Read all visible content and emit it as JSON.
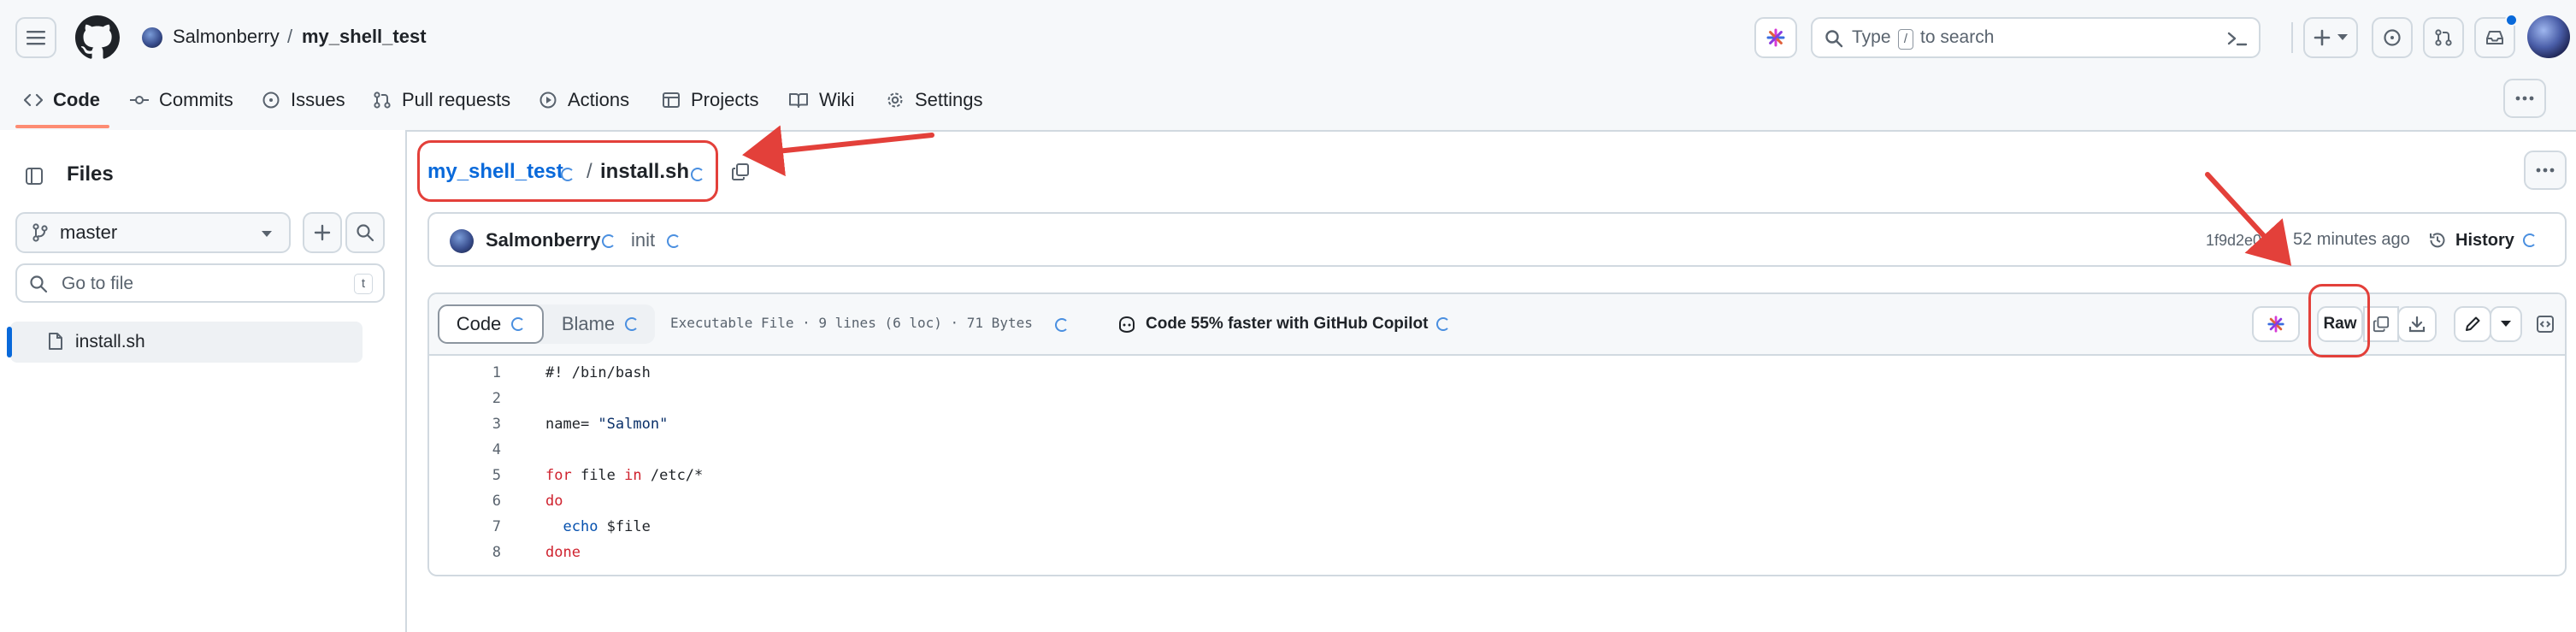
{
  "header": {
    "owner": "Salmonberry",
    "separator": "/",
    "repo": "my_shell_test",
    "search_placeholder_pre": "Type",
    "search_key": "/",
    "search_placeholder_post": "to search"
  },
  "repo_nav": {
    "tabs": [
      {
        "label": "Code",
        "icon": "code-icon"
      },
      {
        "label": "Commits",
        "icon": "commit-icon"
      },
      {
        "label": "Issues",
        "icon": "issue-icon"
      },
      {
        "label": "Pull requests",
        "icon": "pull-request-icon"
      },
      {
        "label": "Actions",
        "icon": "play-icon"
      },
      {
        "label": "Projects",
        "icon": "table-icon"
      },
      {
        "label": "Wiki",
        "icon": "book-icon"
      },
      {
        "label": "Settings",
        "icon": "gear-icon"
      }
    ]
  },
  "sidebar": {
    "title": "Files",
    "branch": "master",
    "filter_placeholder": "Go to file",
    "filter_shortcut": "t",
    "files": [
      {
        "name": "install.sh",
        "selected": true
      }
    ]
  },
  "breadcrumb": {
    "repo": "my_shell_test",
    "separator": "/",
    "file": "install.sh"
  },
  "commit": {
    "author": "Salmonberry",
    "message": "init",
    "sha": "1f9d2e0",
    "time": "52 minutes ago",
    "history_label": "History"
  },
  "file_toolbar": {
    "tab_code": "Code",
    "tab_blame": "Blame",
    "info": "Executable File · 9 lines (6 loc) · 71 Bytes",
    "copilot_label": "Code 55% faster with GitHub Copilot",
    "raw_label": "Raw"
  },
  "code": {
    "lines": [
      {
        "n": "1",
        "segments": [
          {
            "t": "#! /bin/bash",
            "c": "plain"
          }
        ]
      },
      {
        "n": "2",
        "segments": []
      },
      {
        "n": "3",
        "segments": [
          {
            "t": "name= ",
            "c": "plain"
          },
          {
            "t": "\"Salmon\"",
            "c": "str"
          }
        ]
      },
      {
        "n": "4",
        "segments": []
      },
      {
        "n": "5",
        "segments": [
          {
            "t": "for",
            "c": "kw"
          },
          {
            "t": " file ",
            "c": "plain"
          },
          {
            "t": "in",
            "c": "kw"
          },
          {
            "t": " /etc/*",
            "c": "plain"
          }
        ]
      },
      {
        "n": "6",
        "segments": [
          {
            "t": "do",
            "c": "kw"
          }
        ]
      },
      {
        "n": "7",
        "segments": [
          {
            "t": "  ",
            "c": "plain"
          },
          {
            "t": "echo",
            "c": "bi"
          },
          {
            "t": " $file",
            "c": "plain"
          }
        ]
      },
      {
        "n": "8",
        "segments": [
          {
            "t": "done",
            "c": "kw"
          }
        ]
      }
    ]
  },
  "colors": {
    "link": "#0969da",
    "annotation": "#e3403a",
    "active_tab_underline": "#fd8c73"
  }
}
